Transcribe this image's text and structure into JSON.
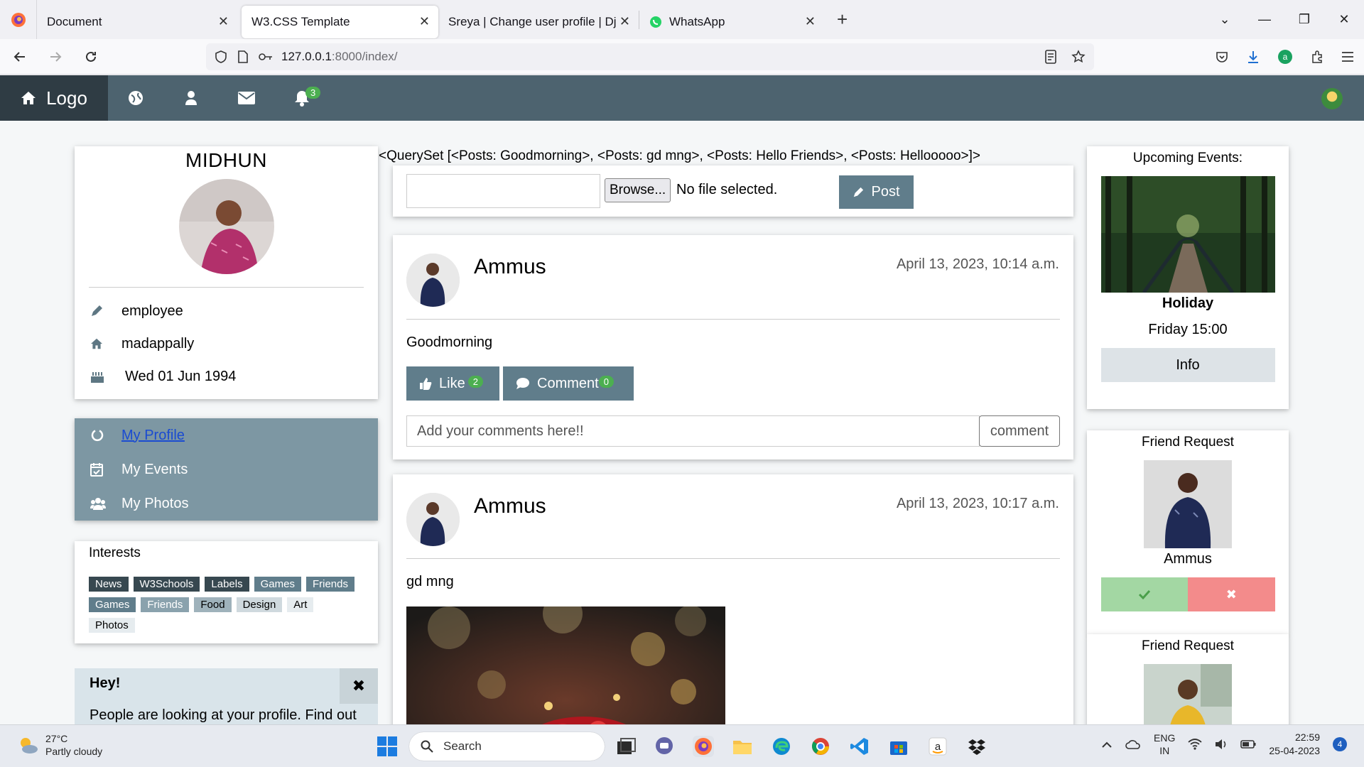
{
  "browser": {
    "tabs": [
      {
        "title": "Document"
      },
      {
        "title": "W3.CSS Template"
      },
      {
        "title": "Sreya | Change user profile | Django"
      },
      {
        "title": "WhatsApp"
      }
    ],
    "url_host": "127.0.0.1",
    "url_rest": ":8000/index/"
  },
  "nav": {
    "logo": "Logo",
    "notification_count": "3"
  },
  "queryset_text": "<QuerySet [<Posts: Goodmorning>, <Posts: gd mng>, <Posts: Hello Friends>, <Posts: Hellooooo>]>",
  "profile": {
    "name": "MIDHUN",
    "job": "employee",
    "place": "madappally",
    "birthday": "Wed 01 Jun 1994"
  },
  "menu": {
    "items": [
      {
        "label": "My Profile",
        "icon": "circle-notch-icon"
      },
      {
        "label": "My Events",
        "icon": "calendar-check-icon"
      },
      {
        "label": "My Photos",
        "icon": "users-icon"
      }
    ]
  },
  "interests": {
    "title": "Interests",
    "tags": [
      "News",
      "W3Schools",
      "Labels",
      "Games",
      "Friends",
      "Games",
      "Friends",
      "Food",
      "Design",
      "Art",
      "Photos"
    ]
  },
  "alert": {
    "title": "Hey!",
    "text": "People are looking at your profile. Find out"
  },
  "uploader": {
    "browse_label": "Browse...",
    "status": "No file selected.",
    "post_label": "Post"
  },
  "posts": [
    {
      "author": "Ammus",
      "date": "April 13, 2023, 10:14 a.m.",
      "text": "Goodmorning",
      "like_label": "Like",
      "like_count": "2",
      "comment_label": "Comment",
      "comment_count": "0",
      "comment_placeholder": "Add your comments here!!",
      "comment_button": "comment"
    },
    {
      "author": "Ammus",
      "date": "April 13, 2023, 10:17 a.m.",
      "text": "gd mng"
    }
  ],
  "events": {
    "title": "Upcoming Events:",
    "name": "Holiday",
    "time": "Friday 15:00",
    "info_label": "Info"
  },
  "friend_requests": [
    {
      "title": "Friend Request",
      "name": "Ammus"
    },
    {
      "title": "Friend Request"
    }
  ],
  "taskbar": {
    "temp": "27°C",
    "weather": "Partly cloudy",
    "search": "Search",
    "lang1": "ENG",
    "lang2": "IN",
    "time": "22:59",
    "date": "25-04-2023",
    "notif_count": "4"
  },
  "colors": {
    "nav": "#4d636f",
    "nav_dark": "#2f3c44",
    "accent": "#607d8b",
    "menu": "#7d97a3",
    "badge": "#4caf50",
    "accept": "#a3d7a3",
    "decline": "#f38b8b"
  }
}
